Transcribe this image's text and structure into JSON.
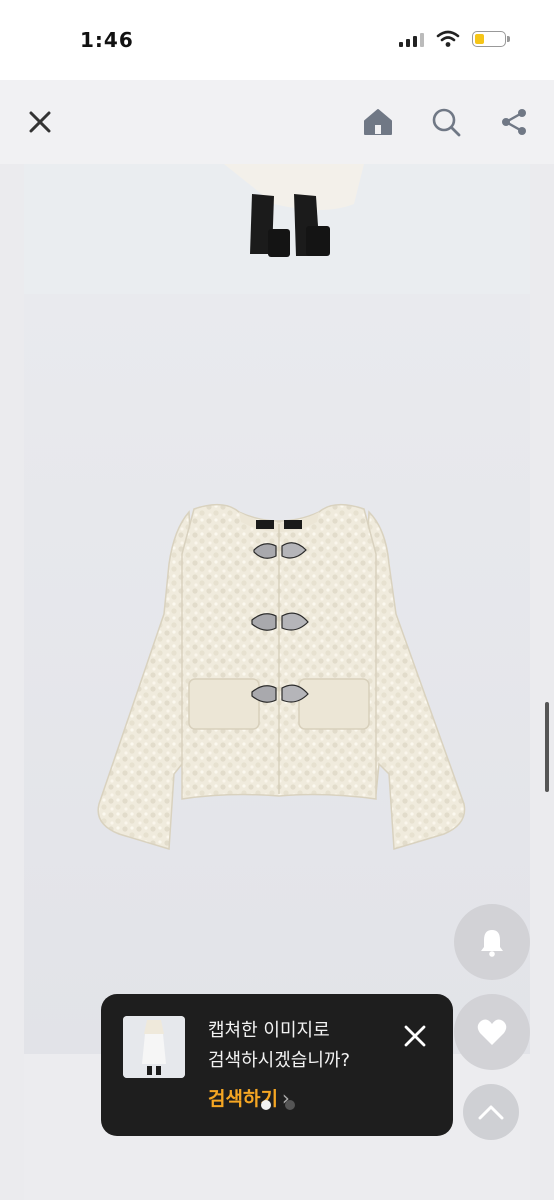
{
  "status": {
    "time": "1:46",
    "battery_color": "#f5c518",
    "battery_level": 0.35
  },
  "nav": {
    "icons": [
      "close-icon",
      "home-icon",
      "search-icon",
      "share-icon"
    ]
  },
  "floating": {
    "icons": [
      "bell-icon",
      "heart-icon",
      "chevron-up-icon"
    ]
  },
  "toast": {
    "message": "캡쳐한 이미지로\n검색하시겠습니까?",
    "action": "검색하기",
    "accent": "#f5a623",
    "page_count": 2,
    "active_page": 1
  }
}
